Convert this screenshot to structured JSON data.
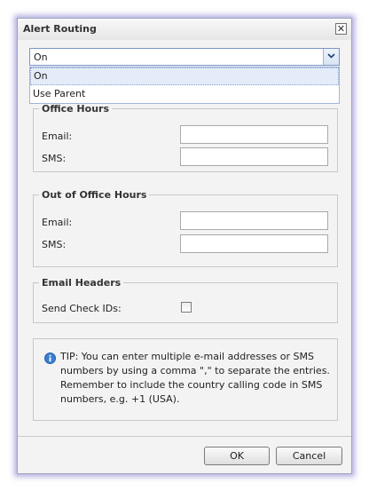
{
  "dialog": {
    "title": "Alert Routing",
    "close_glyph": "✕"
  },
  "routing_select": {
    "value": "On",
    "options": [
      "On",
      "Use Parent"
    ]
  },
  "office_hours": {
    "legend": "Office Hours",
    "email_label": "Email:",
    "sms_label": "SMS:",
    "email_value": "",
    "sms_value": ""
  },
  "out_of_office_hours": {
    "legend": "Out of Office Hours",
    "email_label": "Email:",
    "sms_label": "SMS:",
    "email_value": "",
    "sms_value": ""
  },
  "email_headers": {
    "legend": "Email Headers",
    "send_check_ids_label": "Send Check IDs:",
    "send_check_ids_checked": false
  },
  "tip": {
    "icon": "info-icon",
    "text": "TIP: You can enter multiple e-mail addresses or SMS numbers by using a comma \",\" to separate the entries. Remember to include the country calling code in SMS numbers, e.g. +1 (USA)."
  },
  "buttons": {
    "ok": "OK",
    "cancel": "Cancel"
  },
  "colors": {
    "dialog_background": "#f3f3f3",
    "select_border": "#7a96c6",
    "selected_option": "#e3ecf8",
    "info_icon": "#3a7fd0"
  }
}
